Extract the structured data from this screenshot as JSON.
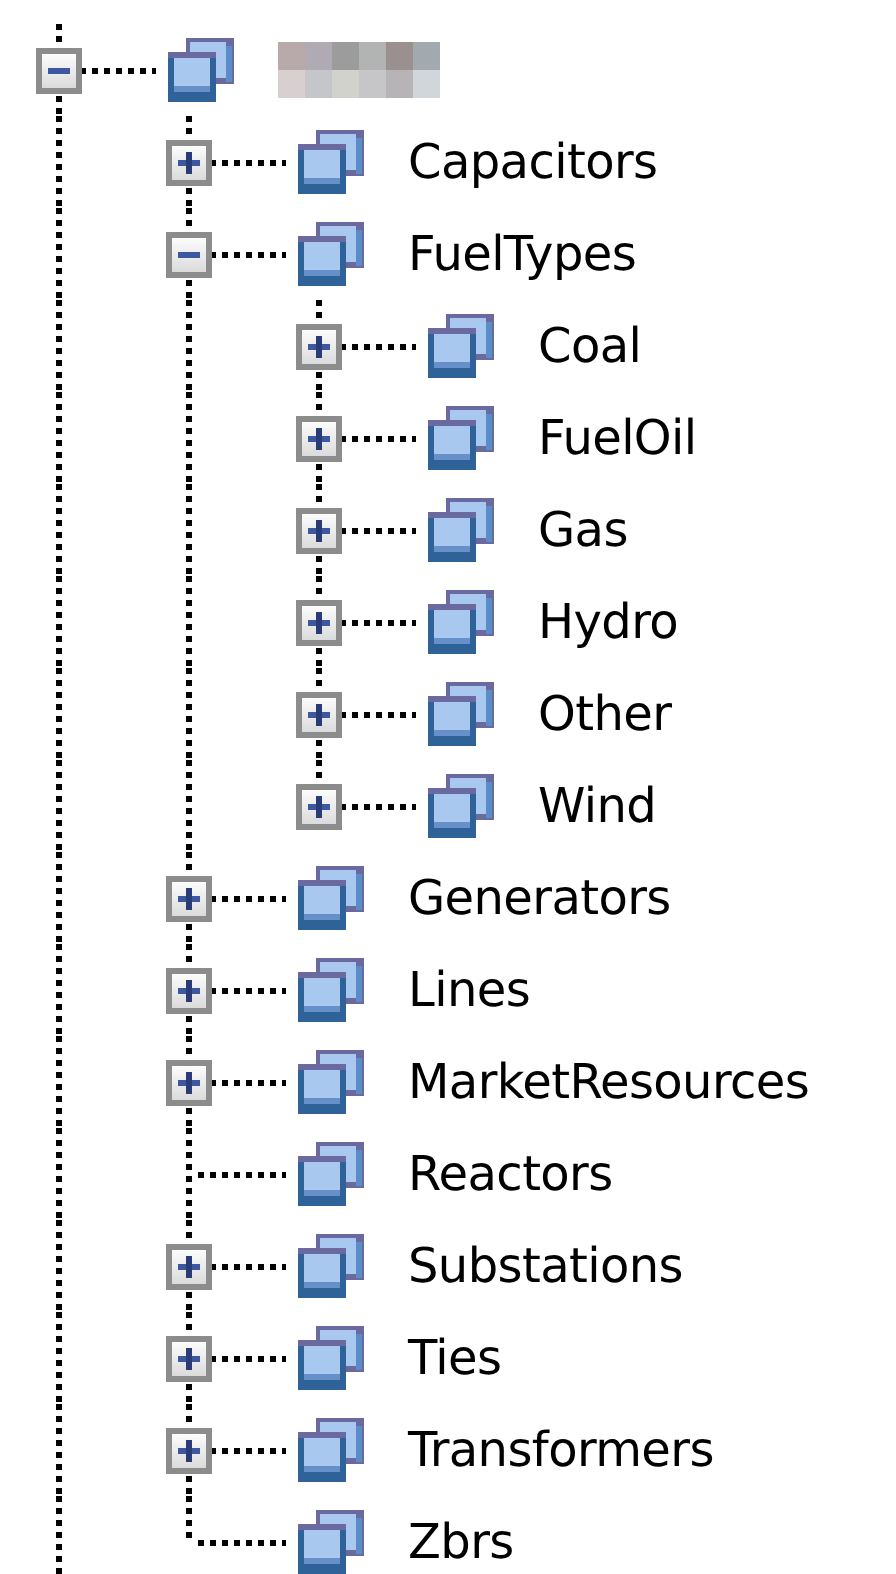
{
  "tree": {
    "expandable": true,
    "expanded": true,
    "redacted": true,
    "children": [
      {
        "label": "Capacitors",
        "expandable": true,
        "expanded": false
      },
      {
        "label": "FuelTypes",
        "expandable": true,
        "expanded": true,
        "children": [
          {
            "label": "Coal",
            "expandable": true,
            "expanded": false
          },
          {
            "label": "FuelOil",
            "expandable": true,
            "expanded": false
          },
          {
            "label": "Gas",
            "expandable": true,
            "expanded": false
          },
          {
            "label": "Hydro",
            "expandable": true,
            "expanded": false
          },
          {
            "label": "Other",
            "expandable": true,
            "expanded": false
          },
          {
            "label": "Wind",
            "expandable": true,
            "expanded": false
          }
        ]
      },
      {
        "label": "Generators",
        "expandable": true,
        "expanded": false
      },
      {
        "label": "Lines",
        "expandable": true,
        "expanded": false
      },
      {
        "label": "MarketResources",
        "expandable": true,
        "expanded": false
      },
      {
        "label": "Reactors",
        "expandable": false
      },
      {
        "label": "Substations",
        "expandable": true,
        "expanded": false
      },
      {
        "label": "Ties",
        "expandable": true,
        "expanded": false
      },
      {
        "label": "Transformers",
        "expandable": true,
        "expanded": false
      },
      {
        "label": "Zbrs",
        "expandable": false
      }
    ]
  }
}
